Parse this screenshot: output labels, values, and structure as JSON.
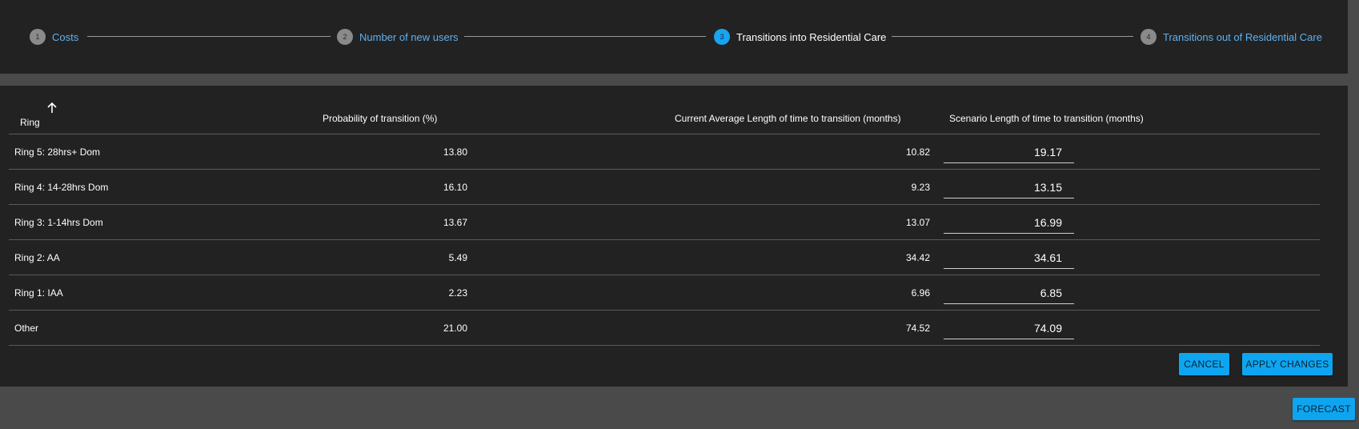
{
  "stepper": {
    "steps": [
      {
        "number": "1",
        "label": "Costs"
      },
      {
        "number": "2",
        "label": "Number of new users"
      },
      {
        "number": "3",
        "label": "Transitions into Residential Care"
      },
      {
        "number": "4",
        "label": "Transitions out of Residential Care"
      }
    ],
    "active_step": 3,
    "colors": {
      "active": "#1aa3f0",
      "inactive_link": "#5fb0f0"
    }
  },
  "table": {
    "columns": {
      "ring": "Ring",
      "probability": "Probability of transition (%)",
      "current": "Current Average Length of time to transition (months)",
      "scenario": "Scenario Length of time to transition (months)"
    },
    "sort_icon": "arrow-up-icon",
    "rows": [
      {
        "ring": "Ring 5: 28hrs+ Dom",
        "probability": "13.80",
        "current": "10.82",
        "scenario": "19.17"
      },
      {
        "ring": "Ring 4: 14-28hrs Dom",
        "probability": "16.10",
        "current": "9.23",
        "scenario": "13.15"
      },
      {
        "ring": "Ring 3: 1-14hrs Dom",
        "probability": "13.67",
        "current": "13.07",
        "scenario": "16.99"
      },
      {
        "ring": "Ring 2: AA",
        "probability": "5.49",
        "current": "34.42",
        "scenario": "34.61"
      },
      {
        "ring": "Ring 1: IAA",
        "probability": "2.23",
        "current": "6.96",
        "scenario": "6.85"
      },
      {
        "ring": "Other",
        "probability": "21.00",
        "current": "74.52",
        "scenario": "74.09"
      }
    ]
  },
  "actions": {
    "cancel": "CANCEL",
    "apply": "APPLY CHANGES",
    "forecast": "FORECAST"
  }
}
